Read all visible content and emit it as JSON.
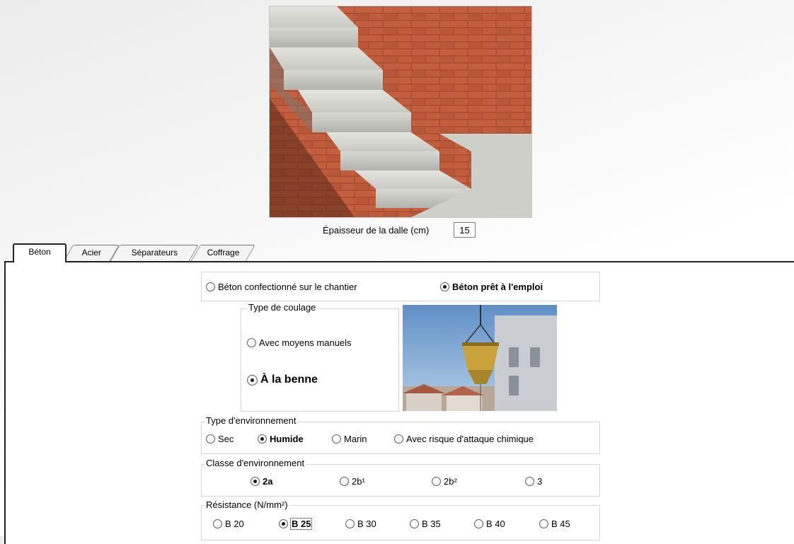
{
  "thickness": {
    "label": "Épaisseur de la dalle (cm)",
    "value": "15"
  },
  "tabs": [
    {
      "label": "Béton",
      "active": true
    },
    {
      "label": "Acier",
      "active": false
    },
    {
      "label": "Séparateurs",
      "active": false
    },
    {
      "label": "Coffrage",
      "active": false
    }
  ],
  "concrete_source": {
    "options": [
      {
        "label": "Béton confectionné sur le chantier",
        "selected": false
      },
      {
        "label": "Béton prêt à l'emploi",
        "selected": true
      }
    ]
  },
  "pouring_type": {
    "legend": "Type de coulage",
    "options": [
      {
        "label": "Avec moyens manuels",
        "selected": false
      },
      {
        "label": "À la benne",
        "selected": true
      }
    ]
  },
  "environment_type": {
    "legend": "Type d'environnement",
    "options": [
      {
        "label": "Sec",
        "selected": false
      },
      {
        "label": "Humide",
        "selected": true
      },
      {
        "label": "Marin",
        "selected": false
      },
      {
        "label": "Avec risque d'attaque chimique",
        "selected": false
      }
    ]
  },
  "environment_class": {
    "legend": "Classe d'environnement",
    "options": [
      {
        "label": "2a",
        "selected": true
      },
      {
        "label": "2b¹",
        "selected": false
      },
      {
        "label": "2b²",
        "selected": false
      },
      {
        "label": "3",
        "selected": false
      }
    ]
  },
  "resistance": {
    "legend": "Résistance (N/mm²)",
    "options": [
      {
        "label": "B 20",
        "selected": false
      },
      {
        "label": "B 25",
        "selected": true
      },
      {
        "label": "B 30",
        "selected": false
      },
      {
        "label": "B 35",
        "selected": false
      },
      {
        "label": "B 40",
        "selected": false
      },
      {
        "label": "B 45",
        "selected": false
      }
    ]
  },
  "colors": {
    "brick": "#b5553a",
    "concrete": "#d9d9d4",
    "sky": "#7fa6cf"
  }
}
